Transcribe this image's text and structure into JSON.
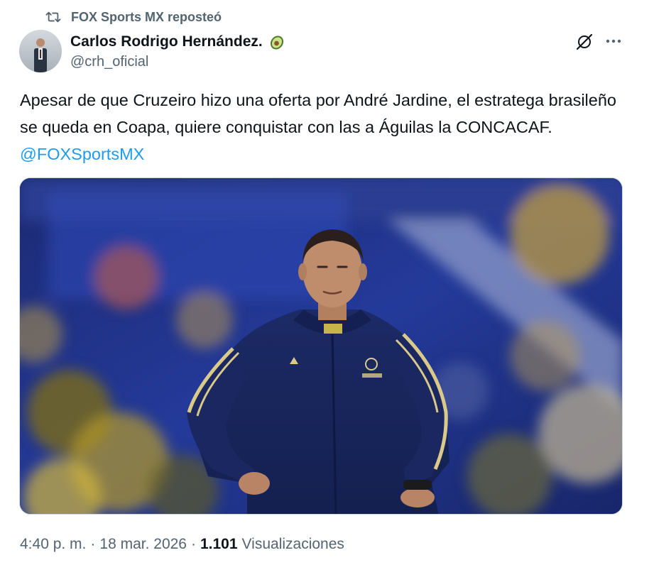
{
  "repost": {
    "label": "FOX Sports MX reposteó",
    "icon": "repost-icon"
  },
  "author": {
    "display_name": "Carlos Rodrigo Hernández.",
    "handle": "@crh_oficial",
    "badge_icon": "avocado-icon"
  },
  "actions": {
    "grok_icon": "grok-icon",
    "more_icon": "more-options-icon"
  },
  "tweet": {
    "text": "Apesar de que Cruzeiro hizo una oferta por André Jardine, el estratega brasileño se queda en Coapa, quiere conquistar con las a Águilas la CONCACAF. ",
    "mention": "@FOXSportsMX"
  },
  "meta": {
    "time": "4:40 p. m.",
    "separator": "·",
    "date": "18 mar. 2026",
    "views_count": "1.101",
    "views_label": "Visualizaciones"
  },
  "colors": {
    "text_primary": "#0f1419",
    "text_secondary": "#536471",
    "link": "#1d9bf0",
    "border": "#cfd9de"
  }
}
